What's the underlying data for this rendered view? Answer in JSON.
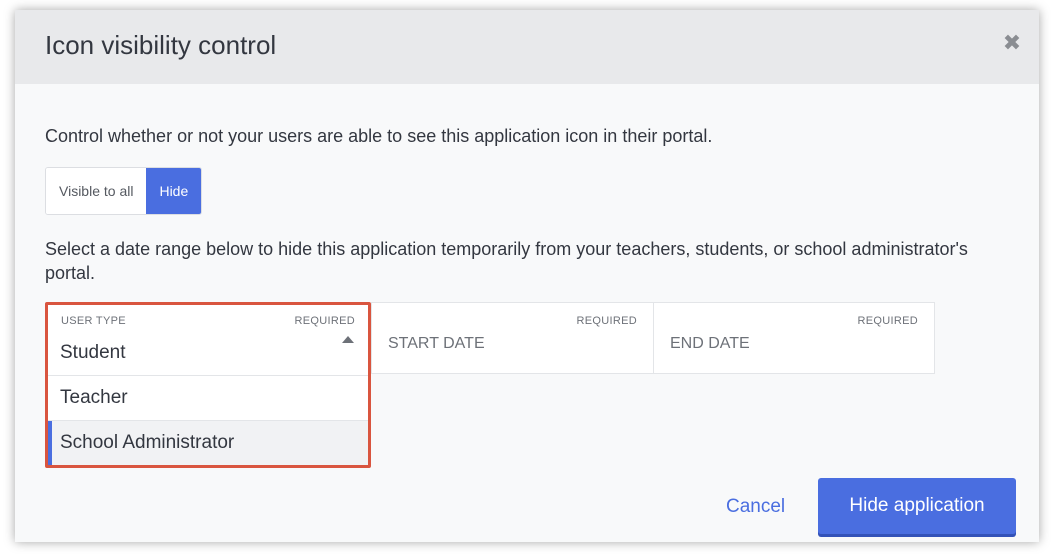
{
  "modal": {
    "title": "Icon visibility control",
    "close_icon": "close-icon",
    "intro": "Control whether or not your users are able to see this application icon in their portal.",
    "toggle": {
      "visible_label": "Visible to all",
      "hide_label": "Hide",
      "selected": "Hide"
    },
    "range_text": "Select a date range below to hide this application temporarily from your teachers, students, or school administrator's portal.",
    "user_type": {
      "label": "USER TYPE",
      "required": "REQUIRED",
      "selected": "Student",
      "options": [
        "Teacher",
        "School Administrator"
      ]
    },
    "start_date": {
      "placeholder": "START DATE",
      "required": "REQUIRED"
    },
    "end_date": {
      "placeholder": "END DATE",
      "required": "REQUIRED"
    },
    "cancel_label": "Cancel",
    "submit_label": "Hide application"
  },
  "colors": {
    "accent": "#4a6ee0",
    "highlight_border": "#d9553f",
    "header_bg": "#e8e9eb"
  }
}
